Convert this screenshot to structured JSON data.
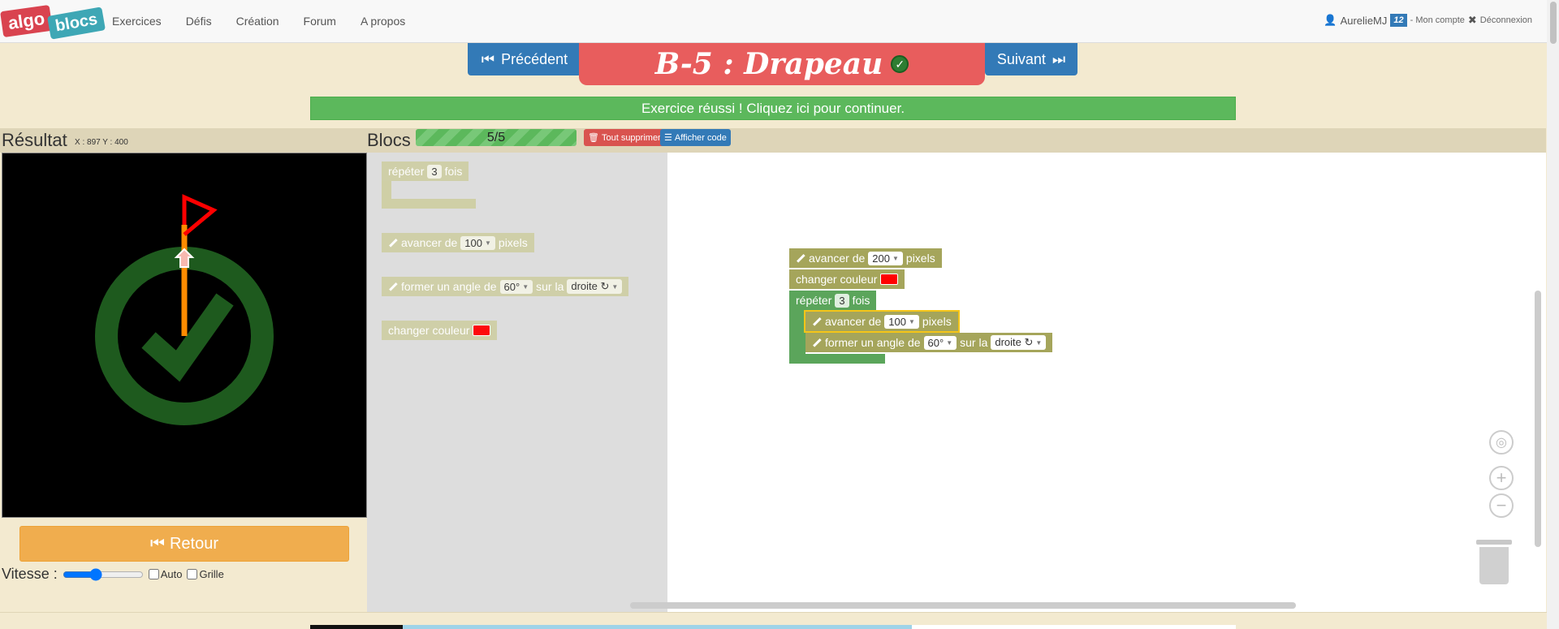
{
  "nav": {
    "logo_algo": "algo",
    "logo_blocs": "blocs",
    "links": [
      "Exercices",
      "Défis",
      "Création",
      "Forum",
      "A propos"
    ],
    "user": "AurelieMJ",
    "badge": "12",
    "account_label": "- Mon compte",
    "logout_label": "Déconnexion"
  },
  "header": {
    "prev_label": "Précédent",
    "title": "B-5 : Drapeau",
    "next_label": "Suivant",
    "success_message": "Exercice réussi ! Cliquez ici pour continuer."
  },
  "result": {
    "title": "Résultat",
    "coords": "X : 897 Y : 400",
    "back_label": "Retour",
    "speed_label": "Vitesse :",
    "auto_label": "Auto",
    "grid_label": "Grille",
    "speed_value": 0.4
  },
  "blocks_panel": {
    "title": "Blocs",
    "progress": "5/5",
    "delete_all_label": "Tout supprimer",
    "show_code_label": "Afficher code"
  },
  "toolbox": {
    "repeat": {
      "prefix": "répéter",
      "count": "3",
      "suffix": "fois"
    },
    "forward": {
      "prefix": "avancer de",
      "value": "100",
      "suffix": "pixels"
    },
    "turn": {
      "prefix": "former un angle de",
      "angle": "60°",
      "middle": "sur la",
      "direction": "droite ↻"
    },
    "color": {
      "label": "changer couleur"
    }
  },
  "program": {
    "forward1": {
      "prefix": "avancer de",
      "value": "200",
      "suffix": "pixels"
    },
    "color": {
      "label": "changer couleur"
    },
    "repeat": {
      "prefix": "répéter",
      "count": "3",
      "suffix": "fois"
    },
    "forward2": {
      "prefix": "avancer de",
      "value": "100",
      "suffix": "pixels"
    },
    "turn": {
      "prefix": "former un angle de",
      "angle": "60°",
      "middle": "sur la",
      "direction": "droite ↻"
    }
  },
  "colors": {
    "block_olive": "#a5a55b",
    "block_green": "#5ba55b",
    "success": "#5cb85c",
    "title_red": "#e85d5d",
    "primary": "#337ab7",
    "warning": "#f0ad4e",
    "pen_color": "#ff0000"
  }
}
